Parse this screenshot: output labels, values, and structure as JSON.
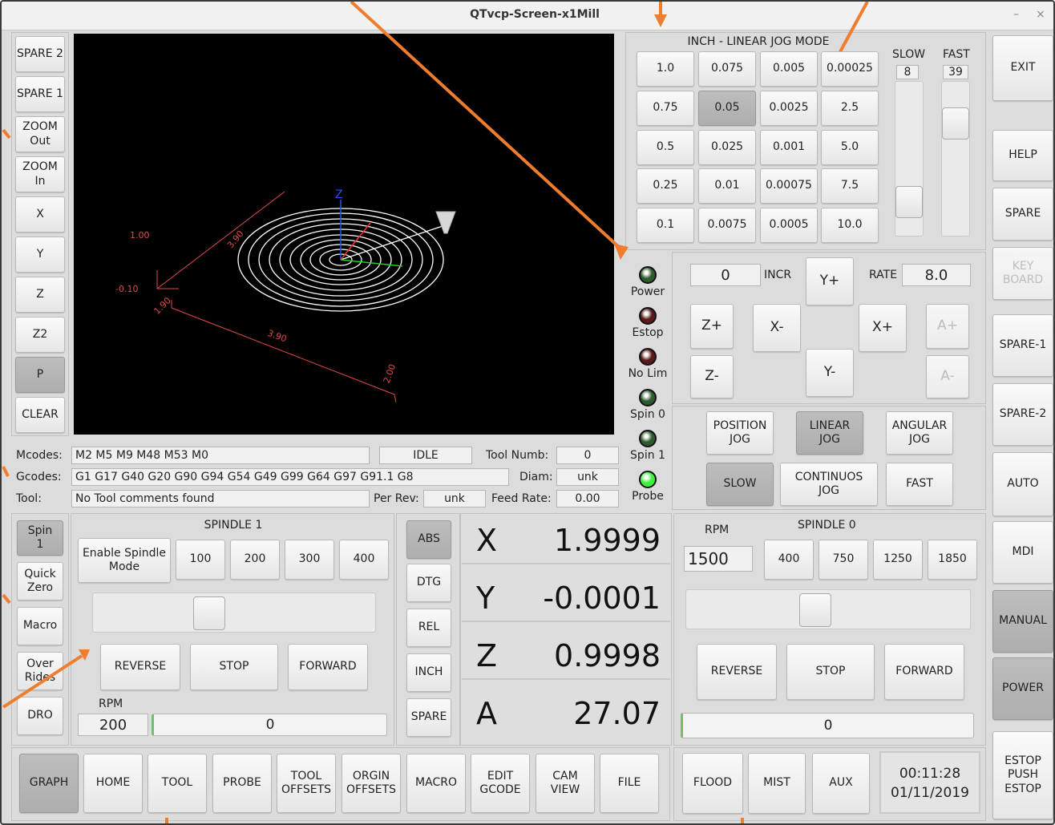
{
  "window": {
    "title": "QTvcp-Screen-x1Mill",
    "minimize": "–",
    "close": "×"
  },
  "left_toolbar": [
    "SPARE 2",
    "SPARE 1",
    "ZOOM\nOut",
    "ZOOM\nIn",
    "X",
    "Y",
    "Z",
    "Z2",
    "P",
    "CLEAR"
  ],
  "preview": {
    "labels": [
      "1.00",
      "-0.10",
      "-0.10",
      "1.90",
      "3.90",
      "2.00",
      "1.90",
      "3.90",
      "Z"
    ]
  },
  "status": {
    "mcodes_label": "Mcodes:",
    "mcodes": "M2 M5 M9 M48 M53 M0",
    "state": "IDLE",
    "tool_numb_label": "Tool Numb:",
    "tool_numb": "0",
    "gcodes_label": "Gcodes:",
    "gcodes": "G1 G17 G40 G20 G90 G94 G54 G49 G99 G64 G97 G91.1 G8",
    "diam_label": "Diam:",
    "diam": "unk",
    "tool_label": "Tool:",
    "tool": "No Tool comments found",
    "per_rev_label": "Per Rev:",
    "per_rev": "unk",
    "feed_rate_label": "Feed Rate:",
    "feed_rate": "0.00"
  },
  "leds": [
    {
      "label": "Power",
      "color": "#2e5a2e"
    },
    {
      "label": "Estop",
      "color": "#5a1a1a"
    },
    {
      "label": "No Lim",
      "color": "#5a1a1a"
    },
    {
      "label": "Spin 0",
      "color": "#2e5a2e"
    },
    {
      "label": "Spin 1",
      "color": "#2e5a2e"
    },
    {
      "label": "Probe",
      "color": "#3cf03c"
    }
  ],
  "jog": {
    "mode_title": "INCH - LINEAR JOG MODE",
    "increments": [
      [
        "1.0",
        "0.075",
        "0.005",
        "0.00025"
      ],
      [
        "0.75",
        "0.05",
        "0.0025",
        "2.5"
      ],
      [
        "0.5",
        "0.025",
        "0.001",
        "5.0"
      ],
      [
        "0.25",
        "0.01",
        "0.00075",
        "7.5"
      ],
      [
        "0.1",
        "0.0075",
        "0.0005",
        "10.0"
      ]
    ],
    "selected_increment": "0.05",
    "slow_label": "SLOW",
    "slow_value": "8",
    "fast_label": "FAST",
    "fast_value": "39",
    "incr_value": "0",
    "incr_label": "INCR",
    "rate_label": "RATE",
    "rate_value": "8.0",
    "buttons": {
      "yplus": "Y+",
      "zplus": "Z+",
      "xminus": "X-",
      "xplus": "X+",
      "aplus": "A+",
      "zminus": "Z-",
      "yminus": "Y-",
      "aminus": "A-"
    },
    "modes": {
      "position": "POSITION\nJOG",
      "linear": "LINEAR\nJOG",
      "angular": "ANGULAR\nJOG",
      "slow": "SLOW",
      "continuous": "CONTINUOS\nJOG",
      "fast": "FAST"
    }
  },
  "right_toolbar": [
    "EXIT",
    "HELP",
    "SPARE",
    "KEY\nBOARD",
    "SPARE-1",
    "SPARE-2",
    "AUTO",
    "MDI",
    "MANUAL",
    "POWER",
    "ESTOP\nPUSH\nESTOP"
  ],
  "spindle_side": [
    "Spin\n1",
    "Quick\nZero",
    "Macro",
    "Over\nRides",
    "DRO"
  ],
  "spindle1": {
    "title": "SPINDLE 1",
    "enable": "Enable Spindle\nMode",
    "presets": [
      "100",
      "200",
      "300",
      "400"
    ],
    "reverse": "REVERSE",
    "stop": "STOP",
    "forward": "FORWARD",
    "rpm_label": "RPM",
    "rpm": "200",
    "bar_value": "0",
    "slider_fraction": 0.4
  },
  "dro_modes": [
    "ABS",
    "DTG",
    "REL",
    "INCH",
    "SPARE"
  ],
  "dro": [
    {
      "axis": "X",
      "value": "1.9999"
    },
    {
      "axis": "Y",
      "value": "-0.0001"
    },
    {
      "axis": "Z",
      "value": "0.9998"
    },
    {
      "axis": "A",
      "value": "27.07"
    }
  ],
  "spindle0": {
    "rpm_label": "RPM",
    "title": "SPINDLE 0",
    "rpm": "1500",
    "presets": [
      "400",
      "750",
      "1250",
      "1850"
    ],
    "reverse": "REVERSE",
    "stop": "STOP",
    "forward": "FORWARD",
    "bar_value": "0",
    "slider_fraction": 0.45
  },
  "bottom_tabs": [
    "GRAPH",
    "HOME",
    "TOOL",
    "PROBE",
    "TOOL\nOFFSETS",
    "ORGIN\nOFFSETS",
    "MACRO",
    "EDIT\nGCODE",
    "CAM\nVIEW",
    "FILE"
  ],
  "coolant": [
    "FLOOD",
    "MIST",
    "AUX"
  ],
  "clock": {
    "time": "00:11:28",
    "date": "01/11/2019"
  }
}
